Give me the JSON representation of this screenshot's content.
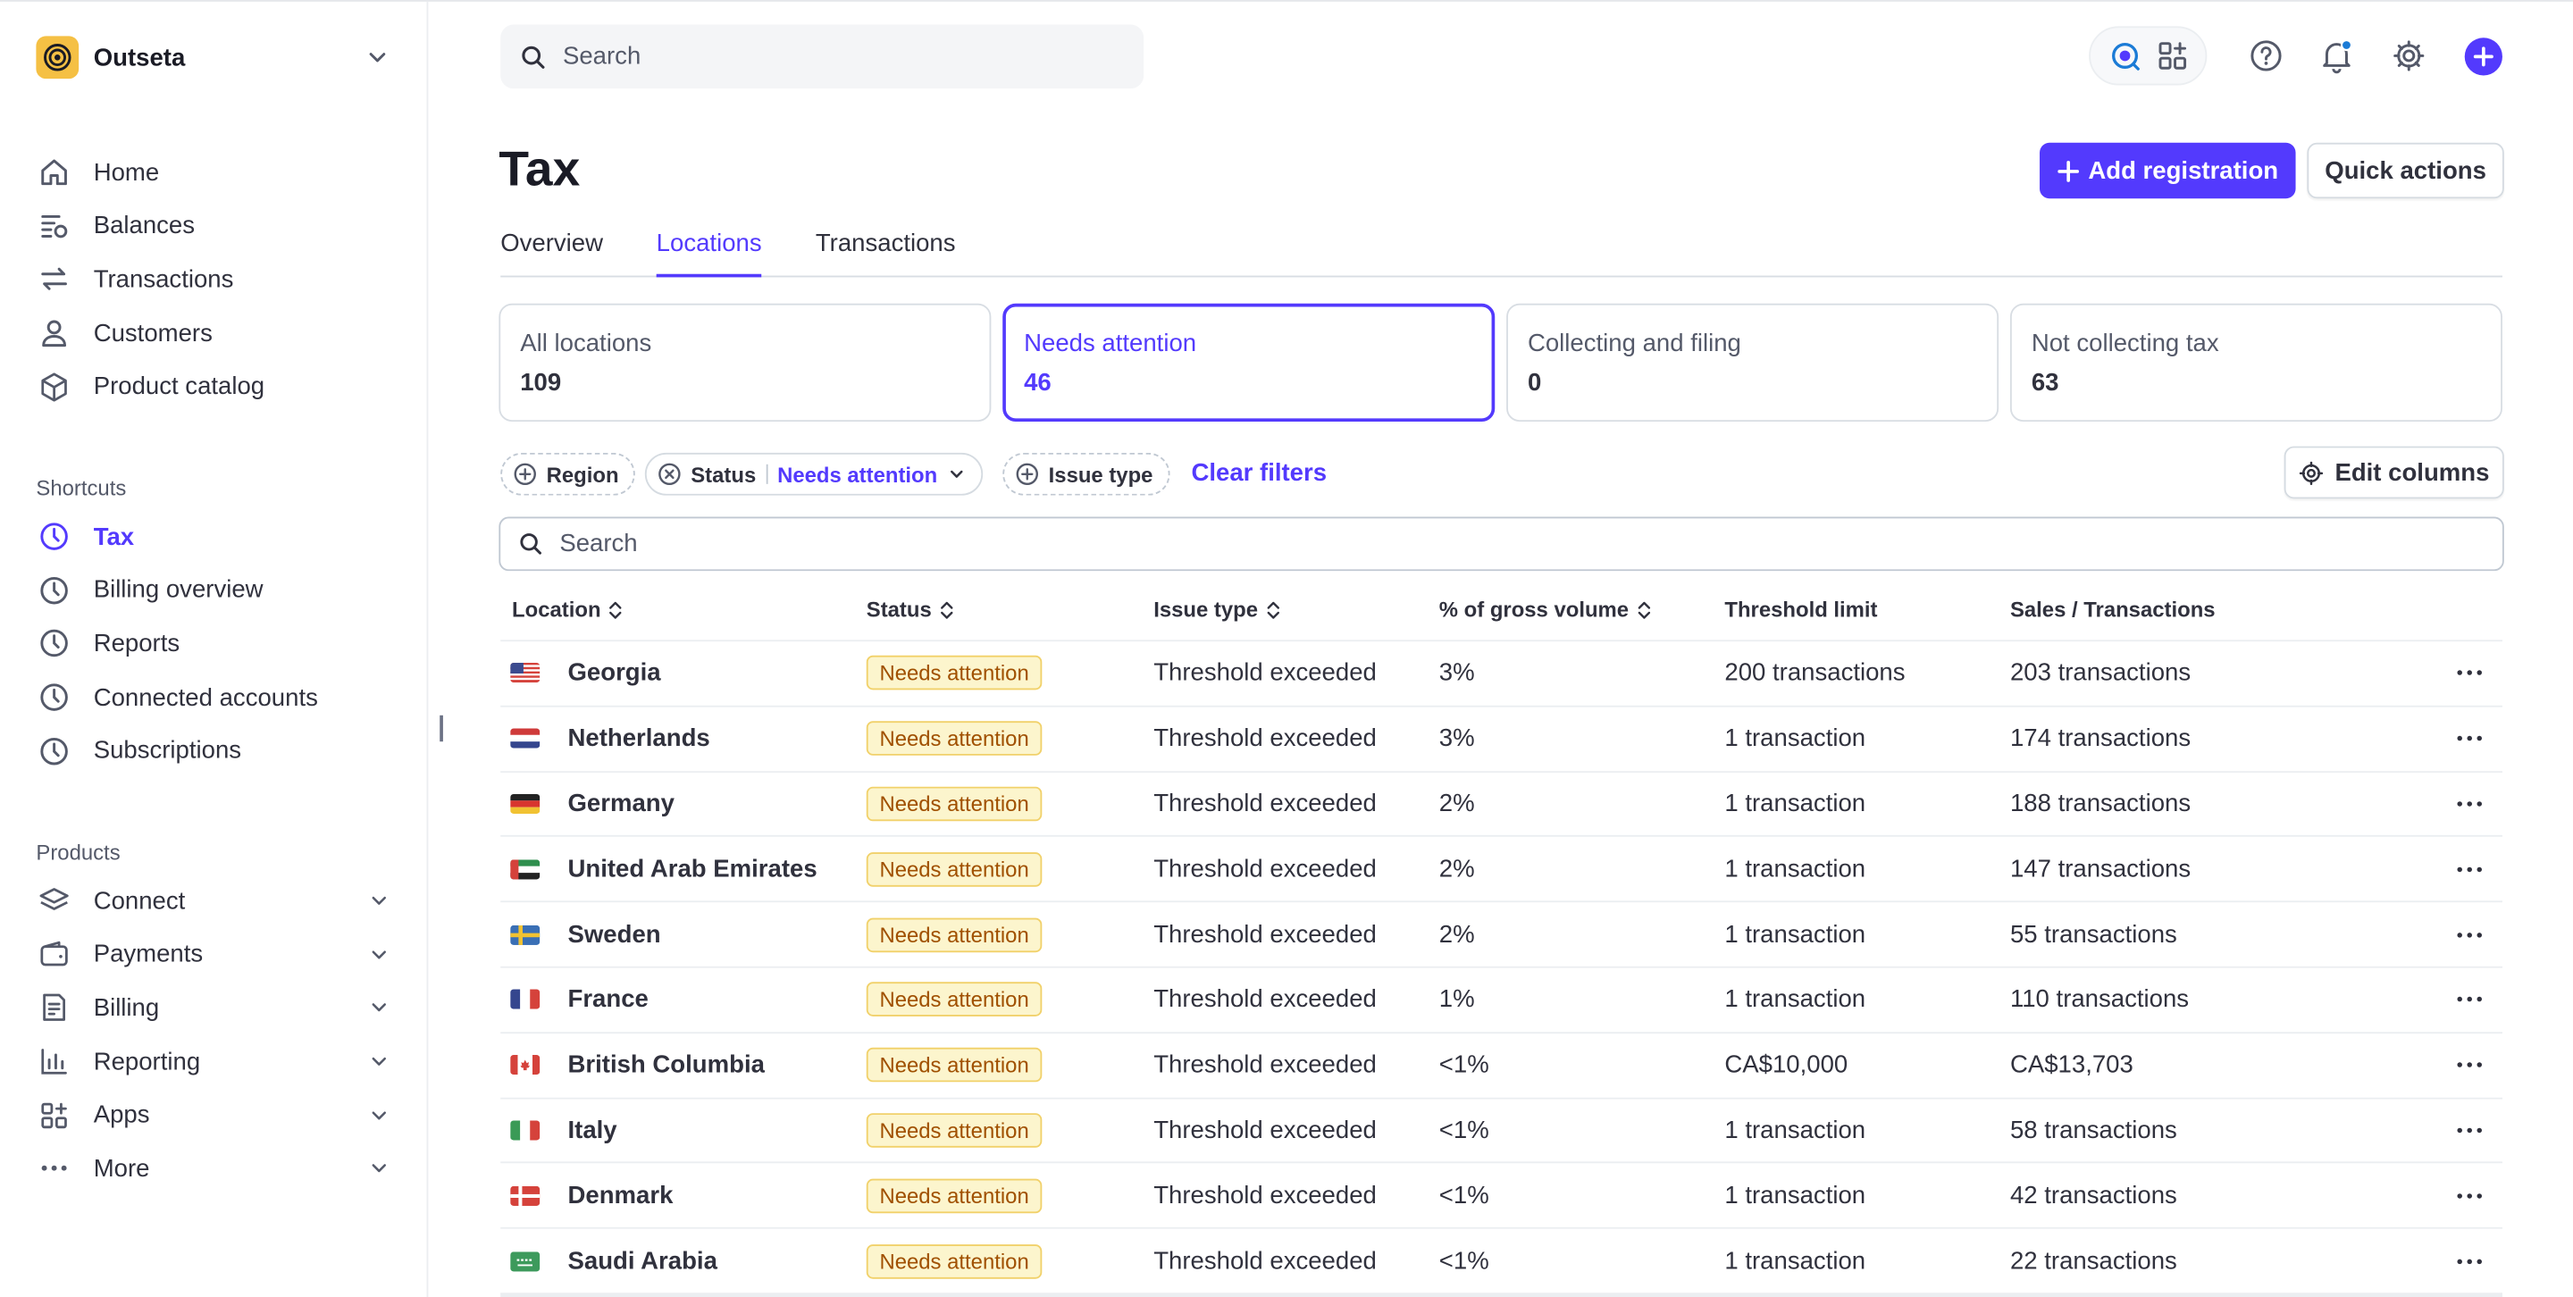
{
  "sidebar": {
    "org_name": "Outseta",
    "nav": [
      {
        "label": "Home",
        "icon": "home-icon"
      },
      {
        "label": "Balances",
        "icon": "balances-icon"
      },
      {
        "label": "Transactions",
        "icon": "arrows-icon"
      },
      {
        "label": "Customers",
        "icon": "person-icon"
      },
      {
        "label": "Product catalog",
        "icon": "box-icon"
      }
    ],
    "shortcuts_label": "Shortcuts",
    "shortcuts": [
      {
        "label": "Tax",
        "active": true
      },
      {
        "label": "Billing overview"
      },
      {
        "label": "Reports"
      },
      {
        "label": "Connected accounts"
      },
      {
        "label": "Subscriptions"
      }
    ],
    "products_label": "Products",
    "products": [
      {
        "label": "Connect",
        "icon": "layers-icon"
      },
      {
        "label": "Payments",
        "icon": "wallet-icon"
      },
      {
        "label": "Billing",
        "icon": "invoice-icon"
      },
      {
        "label": "Reporting",
        "icon": "bar-chart-icon"
      },
      {
        "label": "Apps",
        "icon": "apps-icon"
      },
      {
        "label": "More",
        "icon": "ellipsis-icon"
      }
    ]
  },
  "topbar": {
    "search_placeholder": "Search"
  },
  "header": {
    "title": "Tax",
    "add_registration": "Add registration",
    "quick_actions": "Quick actions"
  },
  "tabs": [
    {
      "label": "Overview"
    },
    {
      "label": "Locations",
      "active": true
    },
    {
      "label": "Transactions"
    }
  ],
  "cards": [
    {
      "label": "All locations",
      "value": "109"
    },
    {
      "label": "Needs attention",
      "value": "46",
      "selected": true
    },
    {
      "label": "Collecting and filing",
      "value": "0"
    },
    {
      "label": "Not collecting tax",
      "value": "63"
    }
  ],
  "filters": {
    "region": "Region",
    "status": "Status",
    "status_value": "Needs attention",
    "issue_type": "Issue type",
    "clear": "Clear filters",
    "edit_columns": "Edit columns"
  },
  "table": {
    "search_placeholder": "Search",
    "columns": {
      "location": "Location",
      "status": "Status",
      "issue_type": "Issue type",
      "gross": "% of gross volume",
      "threshold": "Threshold limit",
      "sales": "Sales / Transactions"
    },
    "rows": [
      {
        "flag": "us",
        "location": "Georgia",
        "status": "Needs attention",
        "issue": "Threshold exceeded",
        "gross": "3%",
        "threshold": "200 transactions",
        "sales": "203 transactions"
      },
      {
        "flag": "nl",
        "location": "Netherlands",
        "status": "Needs attention",
        "issue": "Threshold exceeded",
        "gross": "3%",
        "threshold": "1 transaction",
        "sales": "174 transactions"
      },
      {
        "flag": "de",
        "location": "Germany",
        "status": "Needs attention",
        "issue": "Threshold exceeded",
        "gross": "2%",
        "threshold": "1 transaction",
        "sales": "188 transactions"
      },
      {
        "flag": "ae",
        "location": "United Arab Emirates",
        "status": "Needs attention",
        "issue": "Threshold exceeded",
        "gross": "2%",
        "threshold": "1 transaction",
        "sales": "147 transactions"
      },
      {
        "flag": "se",
        "location": "Sweden",
        "status": "Needs attention",
        "issue": "Threshold exceeded",
        "gross": "2%",
        "threshold": "1 transaction",
        "sales": "55 transactions"
      },
      {
        "flag": "fr",
        "location": "France",
        "status": "Needs attention",
        "issue": "Threshold exceeded",
        "gross": "1%",
        "threshold": "1 transaction",
        "sales": "110 transactions"
      },
      {
        "flag": "ca",
        "location": "British Columbia",
        "status": "Needs attention",
        "issue": "Threshold exceeded",
        "gross": "<1%",
        "threshold": "CA$10,000",
        "sales": "CA$13,703"
      },
      {
        "flag": "it",
        "location": "Italy",
        "status": "Needs attention",
        "issue": "Threshold exceeded",
        "gross": "<1%",
        "threshold": "1 transaction",
        "sales": "58 transactions"
      },
      {
        "flag": "dk",
        "location": "Denmark",
        "status": "Needs attention",
        "issue": "Threshold exceeded",
        "gross": "<1%",
        "threshold": "1 transaction",
        "sales": "42 transactions"
      },
      {
        "flag": "sa",
        "location": "Saudi Arabia",
        "status": "Needs attention",
        "issue": "Threshold exceeded",
        "gross": "<1%",
        "threshold": "1 transaction",
        "sales": "22 transactions"
      }
    ]
  },
  "colors": {
    "accent": "#533afd",
    "badge_bg": "#fcf5cd",
    "badge_text": "#a05000"
  }
}
